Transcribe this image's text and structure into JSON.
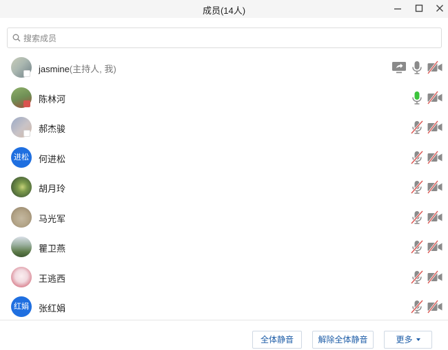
{
  "window": {
    "title": "成员(14人)"
  },
  "search": {
    "placeholder": "搜索成员",
    "value": ""
  },
  "members": [
    {
      "name": "jasmine",
      "tag": "(主持人, 我)",
      "avatar_type": "photo",
      "avatar_colors": [
        "#c8ccb8",
        "#6e7f86"
      ],
      "mic": "active-gray",
      "camera": "off",
      "sharing": true
    },
    {
      "name": "陈林河",
      "tag": "",
      "avatar_type": "photo",
      "avatar_colors": [
        "#8fb06b",
        "#a04d3a"
      ],
      "mic": "speaking",
      "camera": "off",
      "sharing": false
    },
    {
      "name": "郝杰骏",
      "tag": "",
      "avatar_type": "photo",
      "avatar_colors": [
        "#9aa9c7",
        "#d2b8a6"
      ],
      "mic": "muted",
      "camera": "off",
      "sharing": false
    },
    {
      "name": "何进松",
      "tag": "",
      "avatar_type": "text",
      "avatar_text": "进松",
      "mic": "muted",
      "camera": "off",
      "sharing": false
    },
    {
      "name": "胡月玲",
      "tag": "",
      "avatar_type": "photo",
      "avatar_colors": [
        "#4f6a3b",
        "#c7d27a"
      ],
      "mic": "muted",
      "camera": "off",
      "sharing": false
    },
    {
      "name": "马光军",
      "tag": "",
      "avatar_type": "photo",
      "avatar_colors": [
        "#c4b8a0",
        "#8c7b63"
      ],
      "mic": "muted",
      "camera": "off",
      "sharing": false
    },
    {
      "name": "瞿卫燕",
      "tag": "",
      "avatar_type": "photo",
      "avatar_colors": [
        "#5c7a48",
        "#d9dfe7"
      ],
      "mic": "muted",
      "camera": "off",
      "sharing": false
    },
    {
      "name": "王逃西",
      "tag": "",
      "avatar_type": "photo",
      "avatar_colors": [
        "#f1d9df",
        "#c9485a"
      ],
      "mic": "muted",
      "camera": "off",
      "sharing": false
    },
    {
      "name": "张红娟",
      "tag": "",
      "avatar_type": "text",
      "avatar_text": "红娟",
      "mic": "muted",
      "camera": "off",
      "sharing": false
    }
  ],
  "footer": {
    "mute_all": "全体静音",
    "unmute_all": "解除全体静音",
    "more": "更多"
  },
  "colors": {
    "accent_text": "#1f5ea8",
    "text_avatar_bg": "#1f6fe0",
    "speaking": "#3cc43c",
    "icon_gray": "#8a8a8a",
    "muted_slash": "#d9534f"
  }
}
